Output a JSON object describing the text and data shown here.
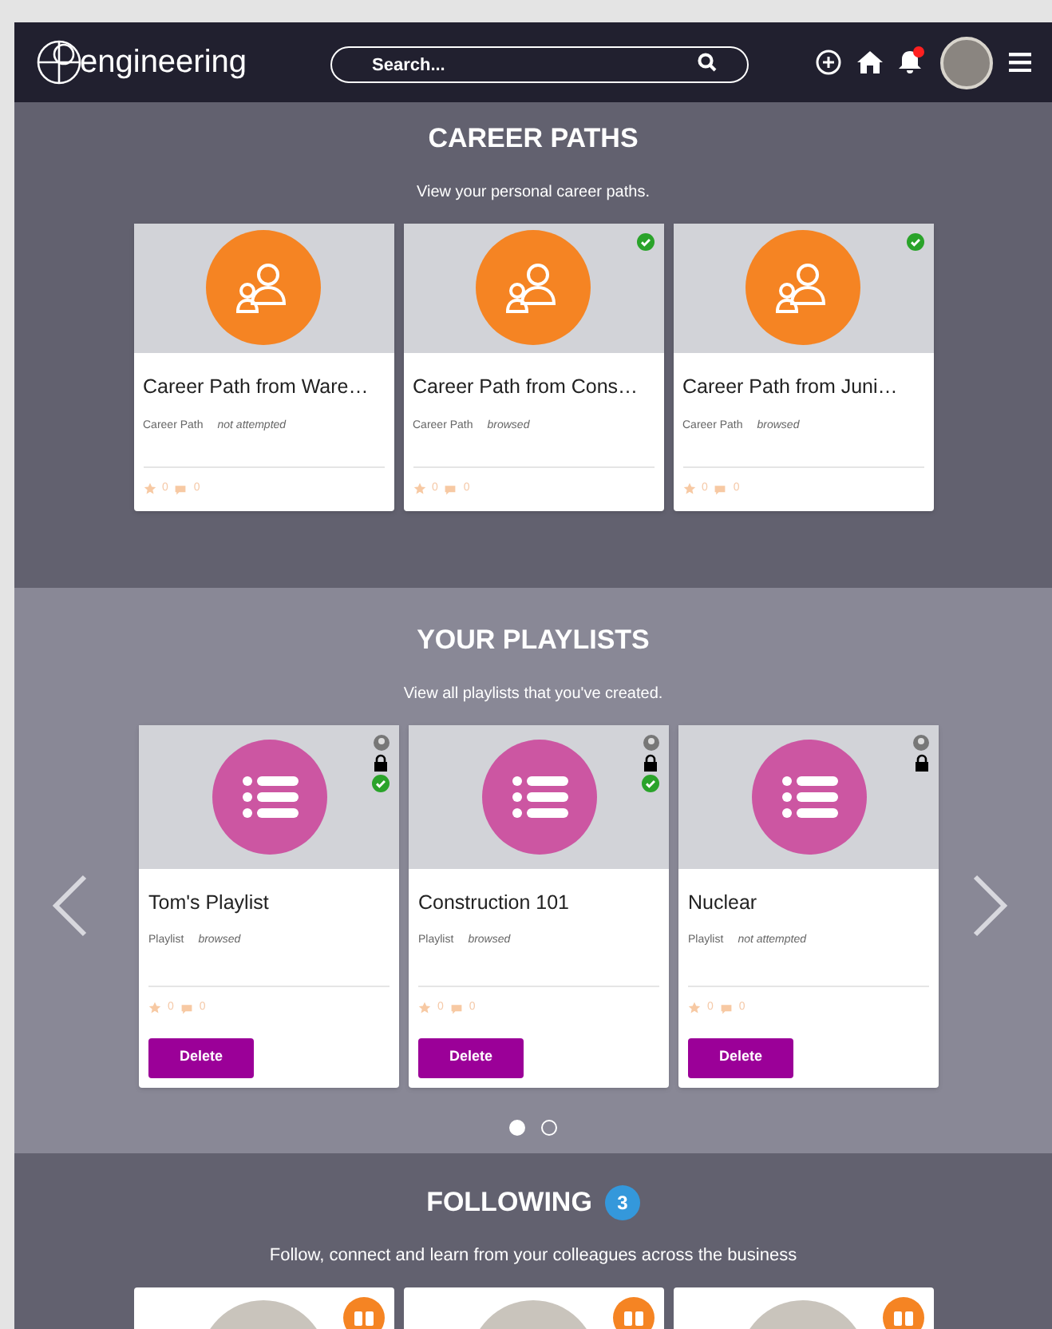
{
  "header": {
    "logo_text": "engineering",
    "search": {
      "placeholder": "Search..."
    },
    "notification": true
  },
  "career_paths": {
    "title": "CAREER PATHS",
    "subtitle": "View your personal career paths.",
    "cards": [
      {
        "title": "Career Path from Ware…",
        "type": "Career Path",
        "status": "not attempted",
        "completed": false,
        "rating": "0",
        "comments": "0"
      },
      {
        "title": "Career Path from Cons…",
        "type": "Career Path",
        "status": "browsed",
        "completed": true,
        "rating": "0",
        "comments": "0"
      },
      {
        "title": "Career Path from Juni…",
        "type": "Career Path",
        "status": "browsed",
        "completed": true,
        "rating": "0",
        "comments": "0"
      }
    ]
  },
  "playlists": {
    "title": "YOUR PLAYLISTS",
    "subtitle": "View all playlists that you've created.",
    "cards": [
      {
        "title": "Tom's Playlist",
        "type": "Playlist",
        "status": "browsed",
        "locked": true,
        "completed": true,
        "rating": "0",
        "comments": "0",
        "button": "Delete"
      },
      {
        "title": "Construction 101",
        "type": "Playlist",
        "status": "browsed",
        "locked": true,
        "completed": true,
        "rating": "0",
        "comments": "0",
        "button": "Delete"
      },
      {
        "title": "Nuclear",
        "type": "Playlist",
        "status": "not attempted",
        "locked": true,
        "completed": false,
        "rating": "0",
        "comments": "0",
        "button": "Delete"
      }
    ],
    "dots": [
      {
        "selected": true
      },
      {
        "selected": false
      }
    ]
  },
  "following": {
    "title": "FOLLOWING",
    "count": "3",
    "subtitle": "Follow, connect and learn from your colleagues across the business",
    "people": [
      {
        "followed": true
      },
      {
        "followed": true
      },
      {
        "followed": true
      }
    ]
  }
}
